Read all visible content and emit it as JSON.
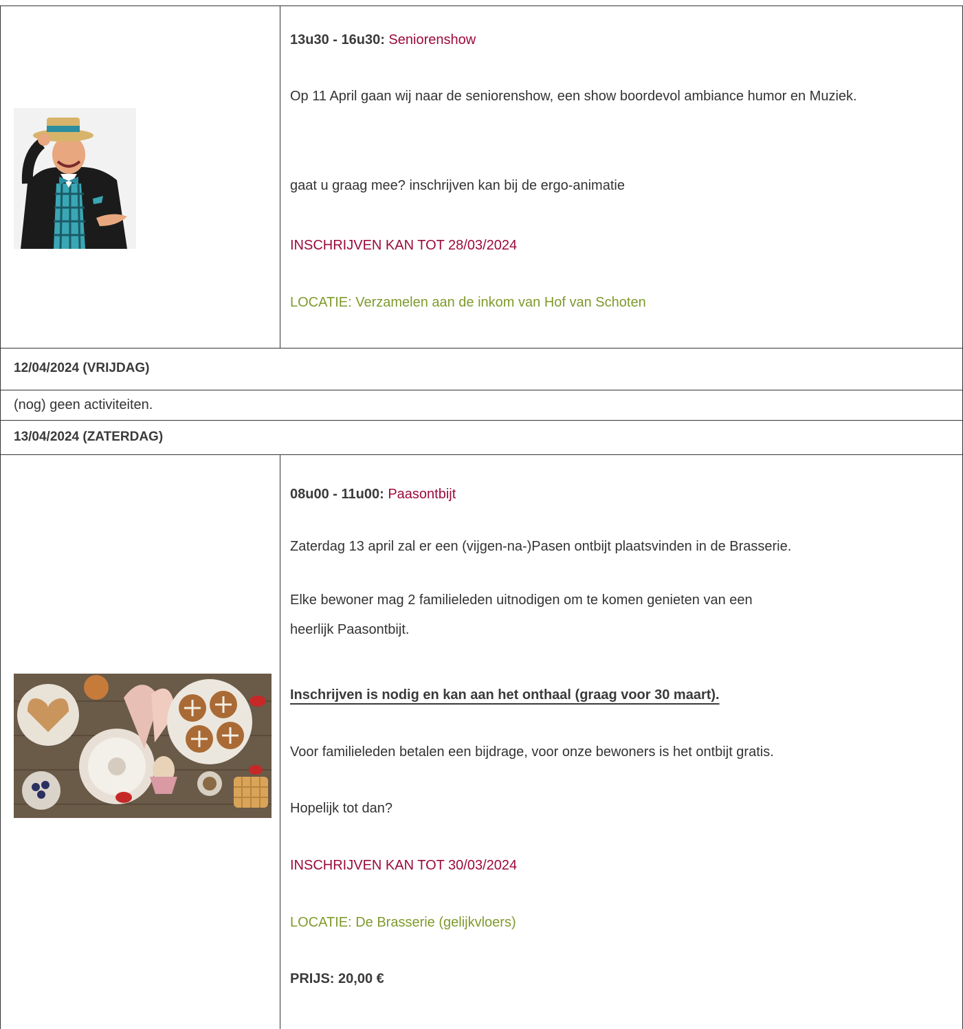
{
  "event1": {
    "time": "13u30 - 16u30:",
    "title": "Seniorenshow",
    "desc1": "Op 11 April gaan wij naar de seniorenshow, een show boordevol ambiance humor en Muziek.",
    "desc2": "gaat u graag mee? inschrijven kan bij de ergo-animatie",
    "deadline": "INSCHRIJVEN KAN TOT 28/03/2024",
    "location": "LOCATIE: Verzamelen aan de inkom van Hof van Schoten",
    "image_icon": "performer-photo"
  },
  "day2": {
    "date": "12/04/2024 (VRIJDAG)",
    "note": "(nog) geen activiteiten."
  },
  "day3": {
    "date": "13/04/2024 (ZATERDAG)"
  },
  "event2": {
    "time": "08u00 - 11u00:",
    "title": "Paasontbijt",
    "desc1": "Zaterdag 13 april zal er een (vijgen-na-)Pasen ontbijt plaatsvinden in de Brasserie.",
    "desc2_line1": "Elke bewoner mag 2 familieleden uitnodigen om te komen genieten van een",
    "desc2_line2": "heerlijk Paasontbijt.",
    "signup_note": "Inschrijven is nodig en kan aan het onthaal (graag voor 30 maart).",
    "desc3": "Voor familieleden betalen een bijdrage, voor onze bewoners is het ontbijt gratis.",
    "desc4": "Hopelijk tot dan?",
    "deadline": "INSCHRIJVEN KAN TOT 30/03/2024",
    "location": "LOCATIE: De Brasserie (gelijkvloers)",
    "price": "PRIJS: 20,00 €",
    "image_icon": "easter-breakfast-photo"
  }
}
